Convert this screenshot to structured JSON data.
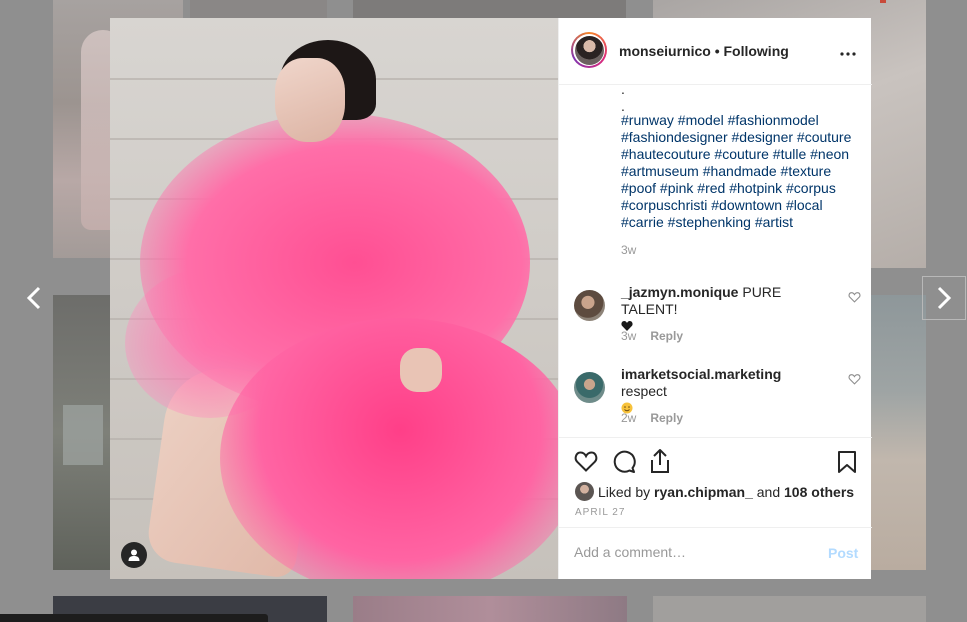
{
  "post": {
    "username": "monseiurnico",
    "separator": "•",
    "follow_status": "Following",
    "more_icon": "•••",
    "caption_dots": [
      ".",
      "."
    ],
    "hashtag_lines": [
      "#runway #model #fashionmodel",
      "#fashiondesigner #designer #couture",
      "#hautecouture #couture #tulle #neon",
      "#artmuseum #handmade #texture",
      "#poof #pink #red #hotpink #corpus",
      "#corpuschristi #downtown #local",
      "#carrie #stephenking #artist"
    ],
    "caption_time": "3w"
  },
  "comments": [
    {
      "username": "_jazmyn.monique",
      "text": "PURE TALENT!",
      "emoji": "black-heart",
      "time": "3w",
      "reply_label": "Reply"
    },
    {
      "username": "imarketsocial.marketing",
      "text": "respect",
      "emoji": "smiling-face",
      "time": "2w",
      "reply_label": "Reply"
    }
  ],
  "likes": {
    "prefix": "Liked by",
    "user": "ryan.chipman_",
    "middle": "and",
    "others": "108 others"
  },
  "date": "APRIL 27",
  "comment_box": {
    "placeholder": "Add a comment…",
    "post_label": "Post"
  },
  "icons": {
    "like": "heart-icon",
    "comment": "comment-bubble-icon",
    "share": "share-icon",
    "save": "bookmark-icon",
    "prev": "chevron-left-icon",
    "next": "chevron-right-icon",
    "user_tag": "user-tag-icon"
  },
  "colors": {
    "hashtag": "#003569",
    "text": "#262626",
    "muted": "#999999",
    "post_disabled": "#b3dbff",
    "dress": "#ff4f93"
  }
}
